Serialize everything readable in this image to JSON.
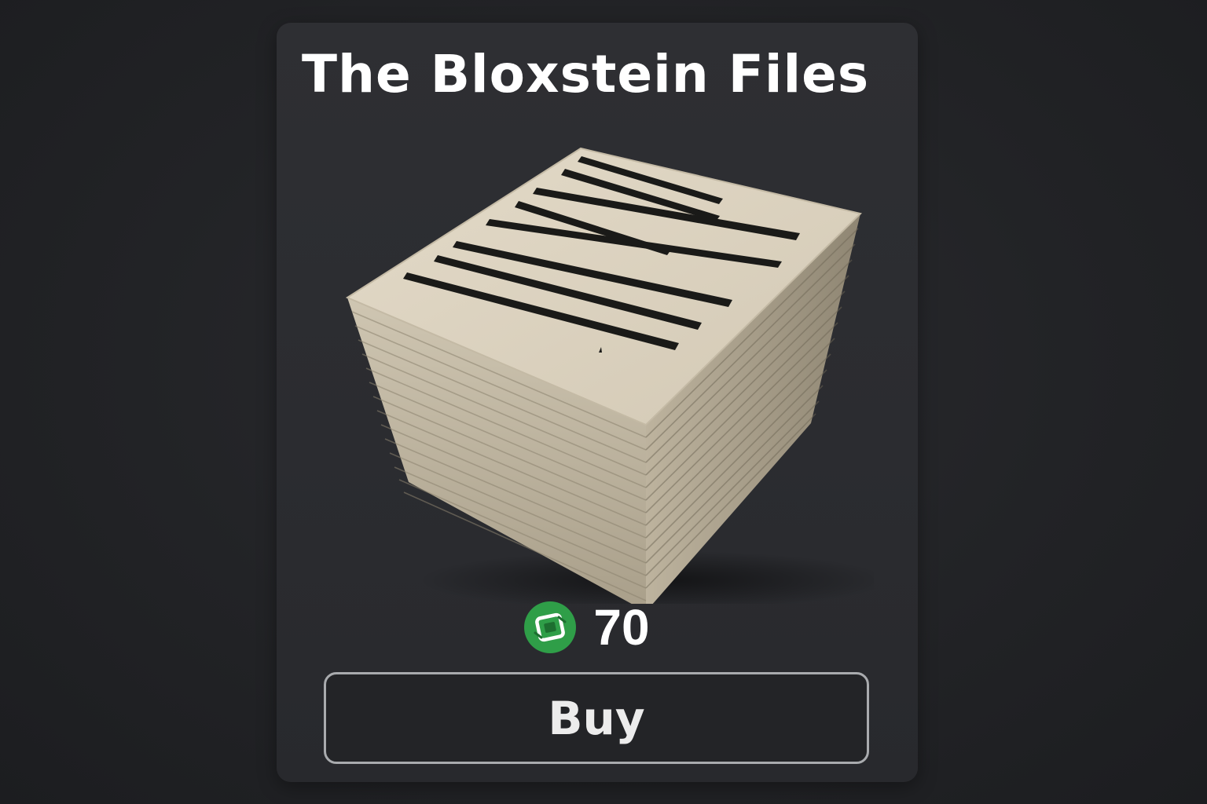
{
  "item": {
    "title": "The Bloxstein Files",
    "image_icon": "paper-stack-redacted-icon",
    "currency_icon": "robux-icon",
    "price": "70",
    "buy_label": "Buy"
  },
  "colors": {
    "background": "#1f2023",
    "card": "#2d2e32",
    "title_text": "#ffffff",
    "currency_green": "#2f9e48",
    "button_border": "#a9abae",
    "button_text": "#ececec",
    "paper": "#ddd3c0",
    "redaction": "#1a1a18"
  }
}
